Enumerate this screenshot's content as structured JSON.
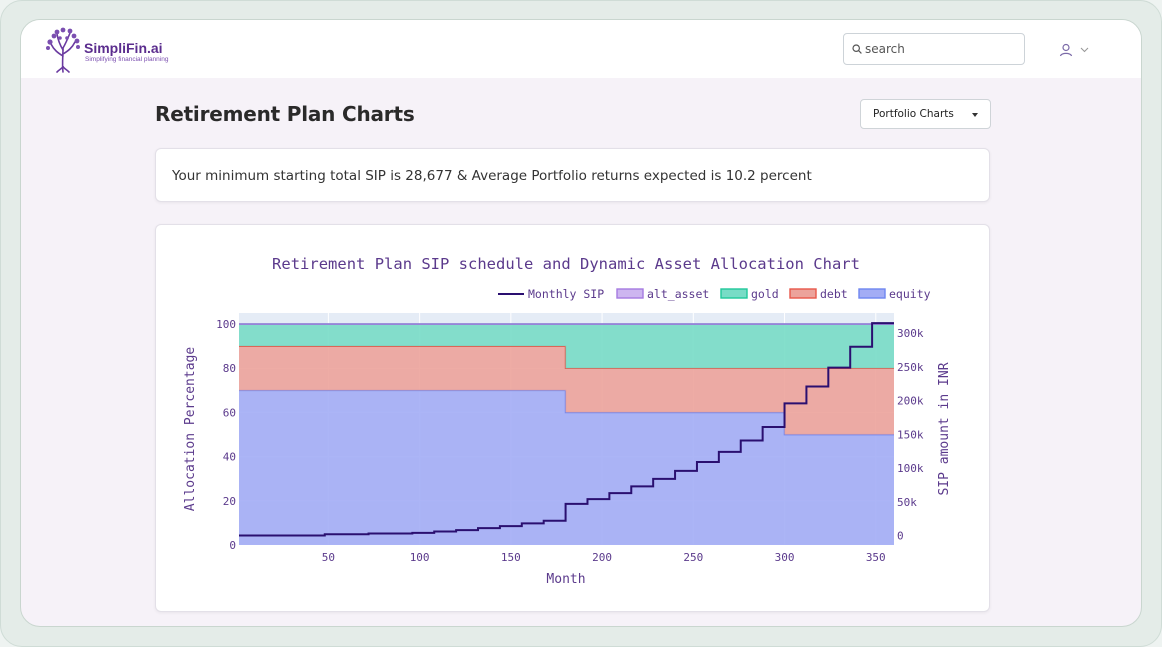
{
  "brand": {
    "name": "SimpliFin.ai",
    "tagline": "Simplifying financial planning",
    "color": "#5b2d8e"
  },
  "search": {
    "placeholder": "search",
    "icon": "search-icon"
  },
  "user_menu": {
    "icon": "user-icon",
    "chevron": "chevron-down-icon"
  },
  "page": {
    "title": "Retirement Plan Charts",
    "dropdown_label": "Portfolio Charts",
    "summary": "Your minimum starting total SIP is 28,677 & Average Portfolio returns expected is 10.2 percent"
  },
  "chart_data": {
    "type": "area",
    "title": "Retirement Plan SIP schedule and Dynamic Asset Allocation Chart",
    "xlabel": "Month",
    "ylabel": "Allocation Percentage",
    "y2label": "SIP amount in INR",
    "xlim": [
      1,
      360
    ],
    "ylim": [
      0,
      105
    ],
    "y2lim": [
      -14000,
      330000
    ],
    "x_ticks": [
      "50",
      "100",
      "150",
      "200",
      "250",
      "300",
      "350"
    ],
    "x_tick_values": [
      50,
      100,
      150,
      200,
      250,
      300,
      350
    ],
    "y_ticks": [
      "0",
      "20",
      "40",
      "60",
      "80",
      "100"
    ],
    "y_tick_values": [
      0,
      20,
      40,
      60,
      80,
      100
    ],
    "y2_ticks": [
      "0",
      "50k",
      "100k",
      "150k",
      "200k",
      "250k",
      "300k"
    ],
    "y2_tick_values": [
      0,
      50000,
      100000,
      150000,
      200000,
      250000,
      300000
    ],
    "legend_position": "top-right",
    "legend": [
      "Monthly SIP",
      "alt_asset",
      "gold",
      "debt",
      "equity"
    ],
    "allocation_series": [
      {
        "name": "equity",
        "color": "#6f86f0",
        "fill": "#a3adf5",
        "x": [
          1,
          180,
          180,
          300,
          300,
          360
        ],
        "values": [
          70,
          70,
          60,
          60,
          50,
          50
        ]
      },
      {
        "name": "debt",
        "color": "#e8574a",
        "fill": "#eca39b",
        "x": [
          1,
          180,
          180,
          300,
          300,
          360
        ],
        "values": [
          20,
          20,
          20,
          20,
          30,
          30
        ]
      },
      {
        "name": "gold",
        "color": "#1fc79a",
        "fill": "#78dcc6",
        "x": [
          1,
          180,
          180,
          300,
          300,
          360
        ],
        "values": [
          10,
          10,
          20,
          20,
          20,
          20
        ]
      },
      {
        "name": "alt_asset",
        "color": "#a57ae0",
        "fill": "#cdb6f0",
        "x": [
          1,
          180,
          180,
          300,
          300,
          360
        ],
        "values": [
          0,
          0,
          0,
          0,
          0,
          0
        ]
      }
    ],
    "sip_series": {
      "name": "Monthly SIP",
      "color": "#2a0f70",
      "x": [
        1,
        48,
        72,
        96,
        108,
        120,
        132,
        144,
        156,
        168,
        180,
        192,
        204,
        216,
        228,
        240,
        252,
        264,
        276,
        288,
        300,
        312,
        324,
        336,
        348,
        360
      ],
      "values": [
        0,
        2000,
        3000,
        4000,
        6000,
        8000,
        11000,
        14000,
        18000,
        22000,
        47000,
        54000,
        63000,
        73000,
        84000,
        96000,
        109000,
        124000,
        141000,
        161000,
        196000,
        221000,
        249000,
        280000,
        315000,
        315000
      ]
    }
  }
}
